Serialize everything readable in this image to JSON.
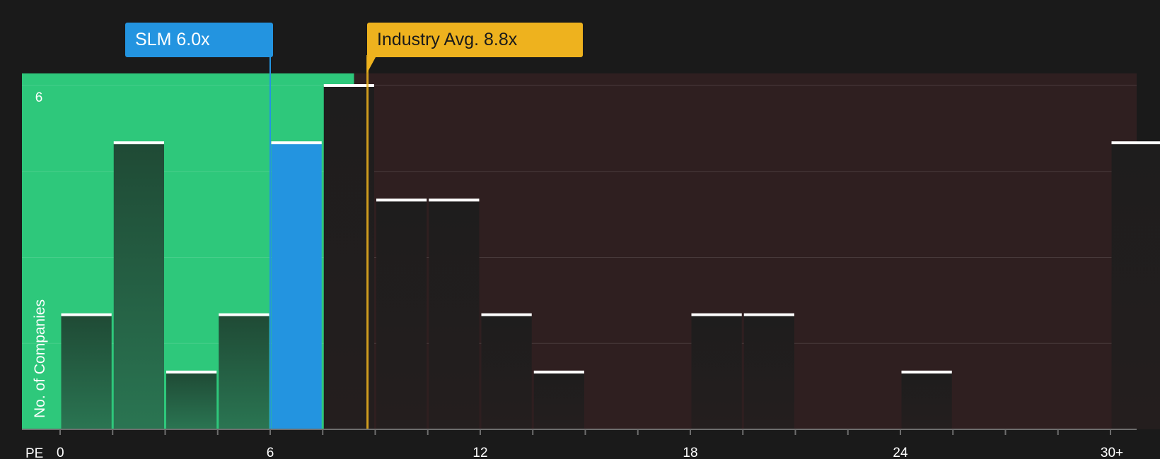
{
  "header": {
    "company_label": "SLM 6.0x",
    "industry_label": "Industry Avg. 8.8x"
  },
  "colors": {
    "background": "#1a1a1a",
    "undervalued_zone": "#2ec87b",
    "overvalued_zone": "#2f1f20",
    "company_bar": "#2394e0",
    "industry_marker": "#eeb21e",
    "bar_cap": "#ffffff"
  },
  "chart_data": {
    "type": "bar",
    "title": "",
    "xlabel": "PE",
    "ylabel": "No. of Companies",
    "x_ticks": [
      "0",
      "6",
      "12",
      "18",
      "24",
      "30+"
    ],
    "x_tick_values": [
      0,
      6,
      12,
      18,
      24,
      30
    ],
    "y_ticks": [
      "6"
    ],
    "y_tick_values": [
      6
    ],
    "xlim": [
      0,
      30.8
    ],
    "ylim": [
      0,
      6.2
    ],
    "bin_width": 1.5,
    "grid": true,
    "company": {
      "name": "SLM",
      "pe": 6.0
    },
    "industry_average": 8.8,
    "bins": [
      {
        "x0": 0,
        "count": 2
      },
      {
        "x0": 1.5,
        "count": 5
      },
      {
        "x0": 3,
        "count": 1
      },
      {
        "x0": 4.5,
        "count": 2
      },
      {
        "x0": 6,
        "count": 5,
        "company": true
      },
      {
        "x0": 7.5,
        "count": 6
      },
      {
        "x0": 9,
        "count": 4
      },
      {
        "x0": 10.5,
        "count": 4
      },
      {
        "x0": 12,
        "count": 2
      },
      {
        "x0": 13.5,
        "count": 1
      },
      {
        "x0": 18,
        "count": 2
      },
      {
        "x0": 19.5,
        "count": 2
      },
      {
        "x0": 24,
        "count": 1
      },
      {
        "x0": 30,
        "count": 5
      }
    ]
  }
}
